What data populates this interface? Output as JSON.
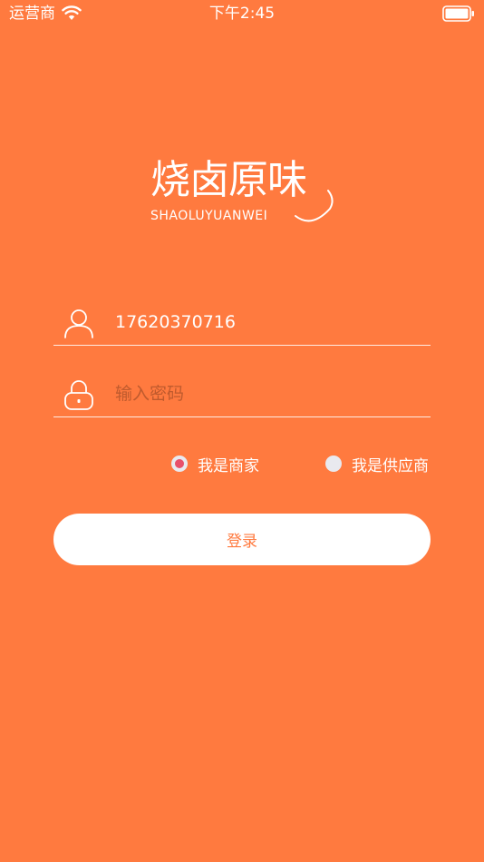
{
  "status_bar": {
    "carrier": "运营商",
    "time": "下午2:45"
  },
  "logo": {
    "title": "烧卤原味",
    "subtitle": "SHAOLUYUANWEI"
  },
  "form": {
    "phone_value": "17620370716",
    "password_placeholder": "输入密码"
  },
  "roles": {
    "merchant_label": "我是商家",
    "supplier_label": "我是供应商",
    "selected": "merchant"
  },
  "login_label": "登录",
  "colors": {
    "background": "#FF7A3F",
    "accent_radio": "#E84F6A",
    "button_bg": "#FFFFFF"
  },
  "icons": {
    "wifi": "wifi-icon",
    "battery": "battery-icon",
    "user": "user-icon",
    "lock": "lock-icon"
  }
}
